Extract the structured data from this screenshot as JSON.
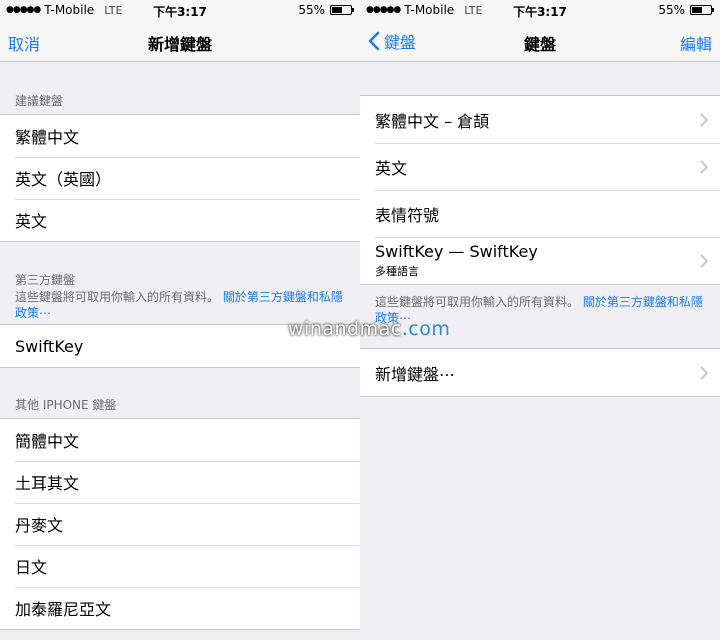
{
  "status_bar": {
    "signal_dots": "●●●●●",
    "carrier": "T-Mobile",
    "network": "LTE",
    "time": "下午3:17",
    "battery_percent": "55%",
    "battery_level": 0.55
  },
  "left_screen": {
    "nav": {
      "cancel_label": "取消",
      "title": "新增鍵盤"
    },
    "suggested": {
      "header": "建議鍵盤",
      "items": [
        "繁體中文",
        "英文（英國）",
        "英文"
      ]
    },
    "third_party": {
      "header": "第三方鍵盤",
      "note": "這些鍵盤將可取用你輸入的所有資料。",
      "link": "關於第三方鍵盤和私隱政策⋯",
      "items": [
        "SwiftKey"
      ]
    },
    "other": {
      "header": "其他 IPHONE 鍵盤",
      "items": [
        "簡體中文",
        "土耳其文",
        "丹麥文",
        "日文",
        "加泰羅尼亞文"
      ]
    }
  },
  "right_screen": {
    "nav": {
      "back_label": "鍵盤",
      "title": "鍵盤",
      "edit_label": "編輯"
    },
    "keyboards": [
      {
        "label": "繁體中文 – 倉頡",
        "sub": ""
      },
      {
        "label": "英文",
        "sub": ""
      },
      {
        "label": "表情符號",
        "sub": ""
      },
      {
        "label": "SwiftKey — SwiftKey",
        "sub": "多種語言"
      }
    ],
    "note": "這些鍵盤將可取用你輸入的所有資料。",
    "link": "關於第三方鍵盤和私隱政策⋯",
    "add_keyboard_label": "新增鍵盤⋯"
  },
  "watermark": {
    "prefix": "winandmac",
    "suffix": ".com"
  },
  "colors": {
    "accent": "#1a7cf5",
    "background": "#efeff4",
    "separator": "#c8c7cc"
  }
}
